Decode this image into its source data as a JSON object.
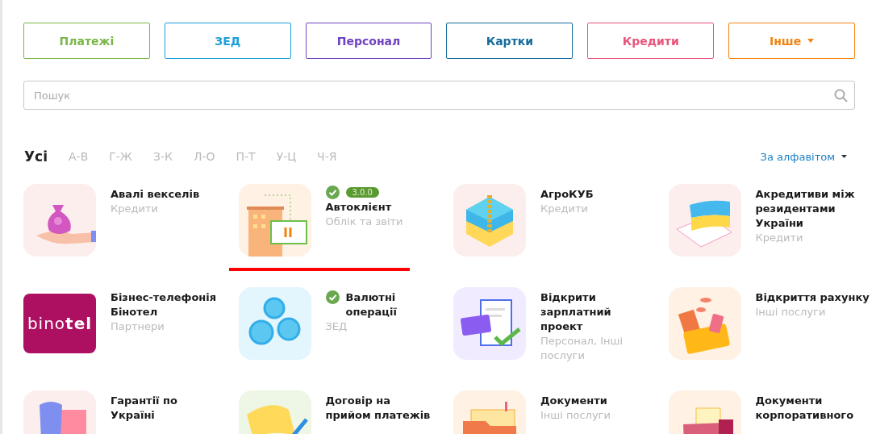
{
  "categories": [
    {
      "label": "Платежі",
      "kind": "link",
      "color": "#7ab648"
    },
    {
      "label": "ЗЕД",
      "kind": "link",
      "color": "#1ea0d8"
    },
    {
      "label": "Персонал",
      "kind": "link",
      "color": "#6f42c1"
    },
    {
      "label": "Картки",
      "kind": "link",
      "color": "#146c9c"
    },
    {
      "label": "Кредити",
      "kind": "link",
      "color": "#e8557a"
    },
    {
      "label": "Інше",
      "kind": "dropdown",
      "color": "#f2830f"
    }
  ],
  "search": {
    "placeholder": "Пошук"
  },
  "letter_filters": [
    {
      "label": "Усі",
      "selected": true
    },
    {
      "label": "А-В",
      "selected": false
    },
    {
      "label": "Г-Ж",
      "selected": false
    },
    {
      "label": "З-К",
      "selected": false
    },
    {
      "label": "Л-О",
      "selected": false
    },
    {
      "label": "П-Т",
      "selected": false
    },
    {
      "label": "У-Ц",
      "selected": false
    },
    {
      "label": "Ч-Я",
      "selected": false
    }
  ],
  "sort": {
    "label": "За алфавітом"
  },
  "apps": [
    {
      "title": "Авалі векселів",
      "category": "Кредити",
      "installed": false,
      "selected": false
    },
    {
      "title": "Автоклієнт",
      "category": "Облік та звіти",
      "installed": true,
      "version": "3.0.0",
      "selected": true
    },
    {
      "title": "АгроКУБ",
      "category": "Кредити",
      "installed": false,
      "selected": false
    },
    {
      "title": "Акредитиви між\nрезидентами\nУкраїни",
      "category": "Кредити",
      "installed": false,
      "selected": false
    },
    {
      "title": "Бізнес-телефонія\nБінотел",
      "category": "Партнери",
      "logo_text": "bino**tel**",
      "installed": false,
      "selected": false
    },
    {
      "title": "Валютні\nоперації",
      "category": "ЗЕД",
      "installed": true,
      "selected": false
    },
    {
      "title": "Відкрити\nзарплатний\nпроект",
      "category": "Персонал, Інші\nпослуги",
      "installed": false,
      "selected": false
    },
    {
      "title": "Відкриття рахунку",
      "category": "Інші послуги",
      "installed": false,
      "selected": false
    },
    {
      "title": "Гарантії по\nУкраїні",
      "installed": false,
      "selected": false
    },
    {
      "title": "Договір на\nприйом платежів",
      "installed": false,
      "selected": false
    },
    {
      "title": "Документи",
      "category": "Інші послуги",
      "installed": false,
      "selected": false
    },
    {
      "title": "Документи\nкорпоративного",
      "installed": false,
      "selected": false
    }
  ]
}
